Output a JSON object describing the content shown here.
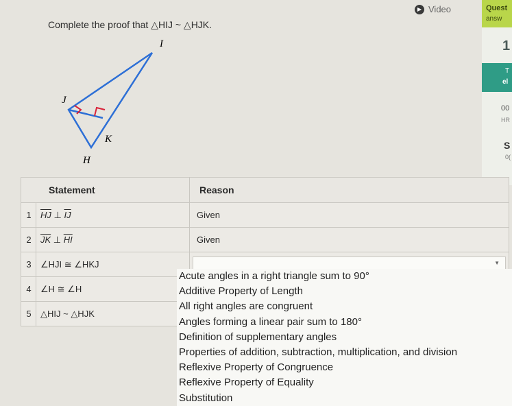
{
  "topbar": {
    "video_label": "Video"
  },
  "question_panel": {
    "title": "Quest",
    "subtitle": "answ",
    "number": "1",
    "teal_top": "T",
    "teal_bottom": "el",
    "time": "00",
    "time_label": "HR",
    "section_letter": "S",
    "section_sub": "0("
  },
  "prompt": "Complete the proof that △HIJ ~ △HJK.",
  "diagram": {
    "labels": {
      "I": "I",
      "J": "J",
      "K": "K",
      "H": "H"
    }
  },
  "table": {
    "headers": {
      "statement": "Statement",
      "reason": "Reason"
    },
    "rows": [
      {
        "num": "1",
        "seg_a": "HJ",
        "rel": "⊥",
        "seg_b": "IJ",
        "reason": "Given"
      },
      {
        "num": "2",
        "seg_a": "JK",
        "rel": "⊥",
        "seg_b": "HI",
        "reason": "Given"
      },
      {
        "num": "3",
        "statement": "∠HJI ≅ ∠HKJ",
        "reason": ""
      },
      {
        "num": "4",
        "statement": "∠H ≅ ∠H",
        "reason": ""
      },
      {
        "num": "5",
        "statement": "△HIJ ~ △HJK",
        "reason": ""
      }
    ]
  },
  "dropdown_options": [
    "Acute angles in a right triangle sum to 90°",
    "Additive Property of Length",
    "All right angles are congruent",
    "Angles forming a linear pair sum to 180°",
    "Definition of supplementary angles",
    "Properties of addition, subtraction, multiplication, and division",
    "Reflexive Property of Congruence",
    "Reflexive Property of Equality",
    "Substitution"
  ]
}
